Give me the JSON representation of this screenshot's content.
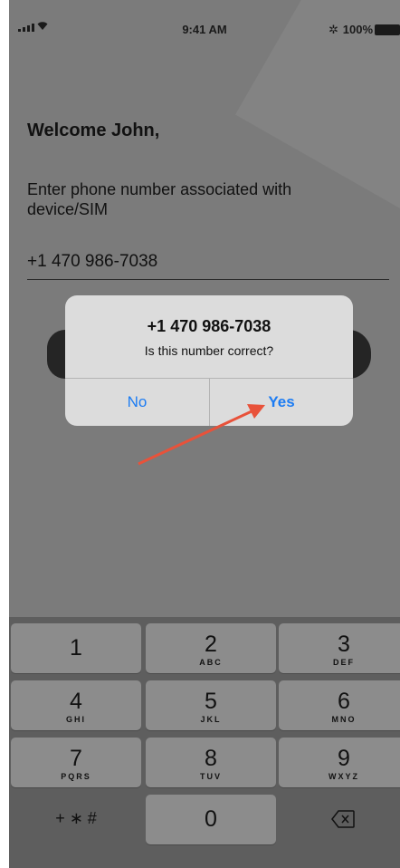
{
  "status_bar": {
    "time": "9:41 AM",
    "battery": "100%",
    "bluetooth_icon": "✲"
  },
  "screen": {
    "welcome": "Welcome John,",
    "instruction": "Enter phone number associated with device/SIM",
    "phone_value": "+1 470 986-7038"
  },
  "dialog": {
    "title": "+1 470 986-7038",
    "message": "Is this number correct?",
    "no_label": "No",
    "yes_label": "Yes"
  },
  "keypad": {
    "keys": [
      {
        "digit": "1",
        "letters": ""
      },
      {
        "digit": "2",
        "letters": "ABC"
      },
      {
        "digit": "3",
        "letters": "DEF"
      },
      {
        "digit": "4",
        "letters": "GHI"
      },
      {
        "digit": "5",
        "letters": "JKL"
      },
      {
        "digit": "6",
        "letters": "MNO"
      },
      {
        "digit": "7",
        "letters": "PQRS"
      },
      {
        "digit": "8",
        "letters": "TUV"
      },
      {
        "digit": "9",
        "letters": "WXYZ"
      }
    ],
    "symbols": "+ ∗ #",
    "zero": "0"
  },
  "colors": {
    "accent": "#1c7cf3",
    "annotation_arrow": "#e8523a",
    "dim_background": "#7b7b7b"
  }
}
